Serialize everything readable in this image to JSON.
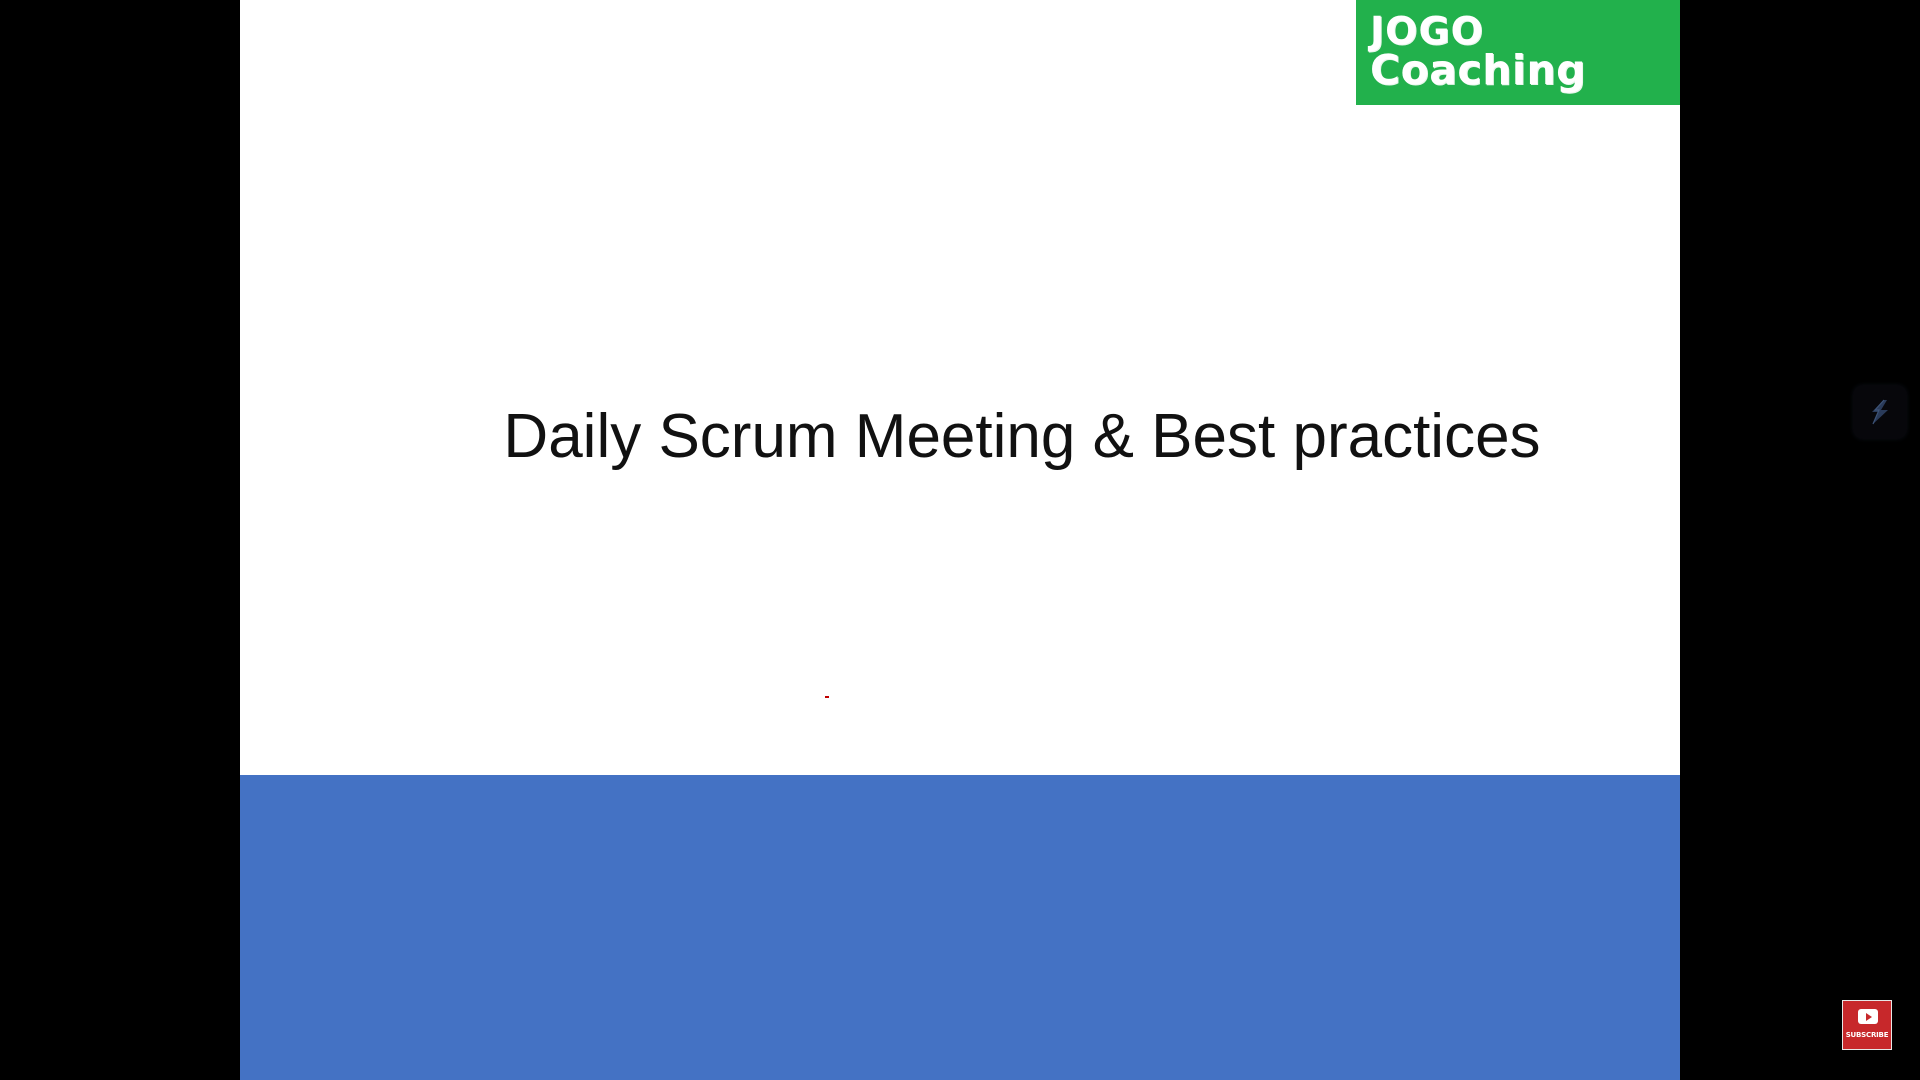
{
  "slide": {
    "logo": {
      "line1": "JOGO",
      "line2": "Coaching"
    },
    "title": "Daily Scrum Meeting & Best practices"
  },
  "overlay": {
    "side_icon": "stylized-s-logo-icon",
    "subscribe": {
      "label": "SUBSCRIBE",
      "icon": "youtube-play-icon"
    }
  },
  "colors": {
    "background": "#000000",
    "slide": "#ffffff",
    "bottom_band": "#4472c4",
    "logo_green": "#22b14c",
    "subscribe_red": "#c7282b",
    "accent_dot": "#c00000"
  }
}
